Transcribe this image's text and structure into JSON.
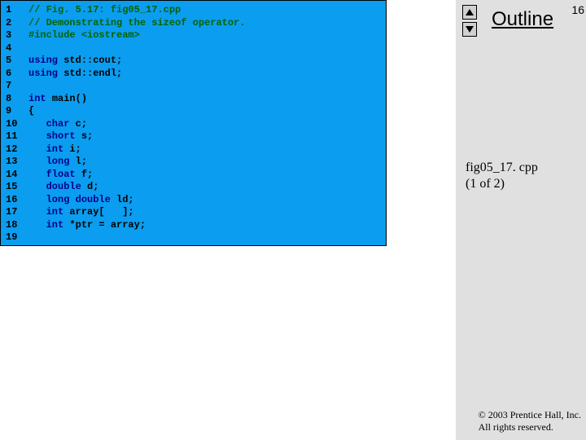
{
  "pageNumber": "16",
  "outlineTitle": "Outline",
  "caption": {
    "line1": "fig05_17. cpp",
    "line2": "(1 of 2)"
  },
  "copyright": {
    "line1": "© 2003 Prentice Hall, Inc.",
    "line2": "All rights reserved."
  },
  "code": [
    {
      "n": "1",
      "segs": [
        {
          "t": "// Fig. 5.17: fig05_17.cpp",
          "c": "cm"
        }
      ]
    },
    {
      "n": "2",
      "segs": [
        {
          "t": "// Demonstrating the sizeof operator.",
          "c": "cm"
        }
      ]
    },
    {
      "n": "3",
      "segs": [
        {
          "t": "#include ",
          "c": "pp"
        },
        {
          "t": "<iostream>",
          "c": "pp"
        }
      ]
    },
    {
      "n": "4",
      "segs": []
    },
    {
      "n": "5",
      "segs": [
        {
          "t": "using ",
          "c": "kw"
        },
        {
          "t": "std::cout;",
          "c": ""
        }
      ]
    },
    {
      "n": "6",
      "segs": [
        {
          "t": "using ",
          "c": "kw"
        },
        {
          "t": "std::endl;",
          "c": ""
        }
      ]
    },
    {
      "n": "7",
      "segs": []
    },
    {
      "n": "8",
      "segs": [
        {
          "t": "int ",
          "c": "kw"
        },
        {
          "t": "main()",
          "c": ""
        }
      ]
    },
    {
      "n": "9",
      "segs": [
        {
          "t": "{",
          "c": ""
        }
      ]
    },
    {
      "n": "10",
      "segs": [
        {
          "t": "   ",
          "c": ""
        },
        {
          "t": "char ",
          "c": "kw"
        },
        {
          "t": "c;",
          "c": ""
        }
      ]
    },
    {
      "n": "11",
      "segs": [
        {
          "t": "   ",
          "c": ""
        },
        {
          "t": "short ",
          "c": "kw"
        },
        {
          "t": "s;",
          "c": ""
        }
      ]
    },
    {
      "n": "12",
      "segs": [
        {
          "t": "   ",
          "c": ""
        },
        {
          "t": "int ",
          "c": "kw"
        },
        {
          "t": "i;",
          "c": ""
        }
      ]
    },
    {
      "n": "13",
      "segs": [
        {
          "t": "   ",
          "c": ""
        },
        {
          "t": "long ",
          "c": "kw"
        },
        {
          "t": "l;",
          "c": ""
        }
      ]
    },
    {
      "n": "14",
      "segs": [
        {
          "t": "   ",
          "c": ""
        },
        {
          "t": "float ",
          "c": "kw"
        },
        {
          "t": "f;",
          "c": ""
        }
      ]
    },
    {
      "n": "15",
      "segs": [
        {
          "t": "   ",
          "c": ""
        },
        {
          "t": "double ",
          "c": "kw"
        },
        {
          "t": "d;",
          "c": ""
        }
      ]
    },
    {
      "n": "16",
      "segs": [
        {
          "t": "   ",
          "c": ""
        },
        {
          "t": "long double ",
          "c": "kw"
        },
        {
          "t": "ld;",
          "c": ""
        }
      ]
    },
    {
      "n": "17",
      "segs": [
        {
          "t": "   ",
          "c": ""
        },
        {
          "t": "int ",
          "c": "kw"
        },
        {
          "t": "array[   ];",
          "c": ""
        }
      ]
    },
    {
      "n": "18",
      "segs": [
        {
          "t": "   ",
          "c": ""
        },
        {
          "t": "int ",
          "c": "kw"
        },
        {
          "t": "*ptr = array;",
          "c": ""
        }
      ]
    },
    {
      "n": "19",
      "segs": []
    }
  ]
}
